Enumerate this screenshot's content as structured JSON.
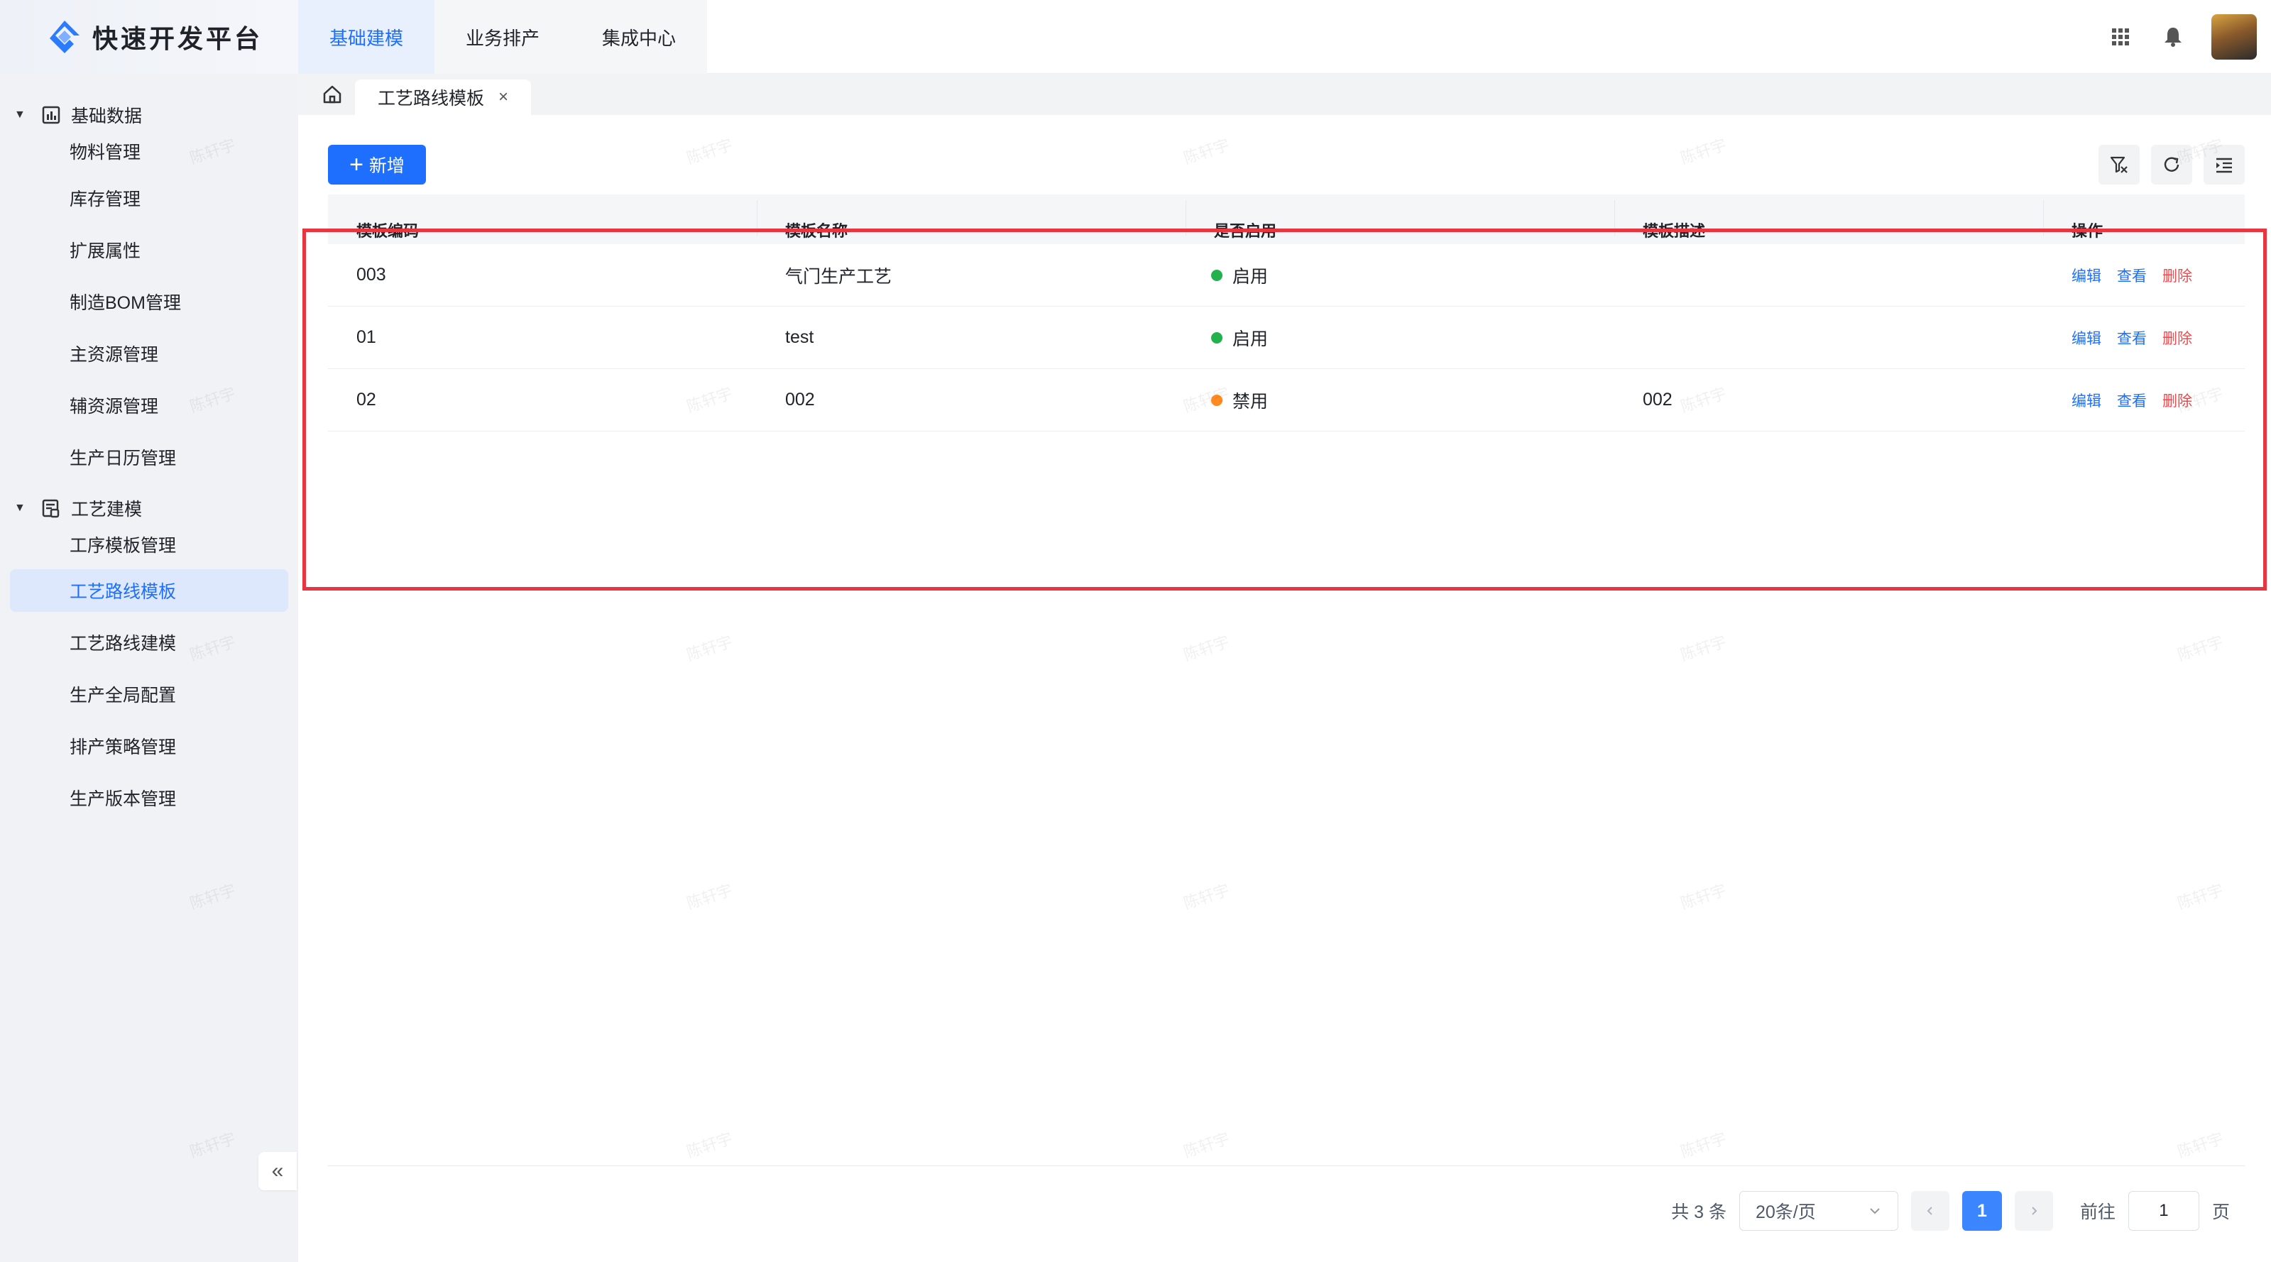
{
  "app": {
    "title": "快速开发平台",
    "top_nav": [
      {
        "label": "基础建模",
        "active": true
      },
      {
        "label": "业务排产",
        "active": false
      },
      {
        "label": "集成中心",
        "active": false
      }
    ],
    "header_icons": [
      "apps-grid-icon",
      "bell-icon",
      "user-avatar"
    ]
  },
  "sidebar": {
    "groups": [
      {
        "label": "基础数据",
        "icon": "bar-chart-icon",
        "items": [
          "物料管理",
          "库存管理",
          "扩展属性",
          "制造BOM管理",
          "主资源管理",
          "辅资源管理",
          "生产日历管理"
        ]
      },
      {
        "label": "工艺建模",
        "icon": "document-icon",
        "items": [
          "工序模板管理",
          "工艺路线模板",
          "工艺路线建模",
          "生产全局配置",
          "排产策略管理",
          "生产版本管理"
        ]
      }
    ],
    "active_item": "工艺路线模板",
    "collapse_label": "«"
  },
  "tabs": {
    "current": "工艺路线模板",
    "close_label": "×"
  },
  "toolbar": {
    "add_label": "新增",
    "add_icon": "+"
  },
  "table": {
    "headers": [
      "模板编码",
      "模板名称",
      "是否启用",
      "模板描述",
      "操作"
    ],
    "rows": [
      {
        "code": "003",
        "name": "气门生产工艺",
        "status": "启用",
        "status_color": "#22b14c",
        "desc": ""
      },
      {
        "code": "01",
        "name": "test",
        "status": "启用",
        "status_color": "#22b14c",
        "desc": ""
      },
      {
        "code": "02",
        "name": "002",
        "status": "禁用",
        "status_color": "#ff8a1f",
        "desc": "002"
      }
    ],
    "actions": {
      "edit": "编辑",
      "view": "查看",
      "delete": "删除"
    }
  },
  "pagination": {
    "total": "共 3 条",
    "page_size": "20条/页",
    "current_page": "1",
    "goto_label": "前往",
    "goto_value": "1",
    "page_unit": "页"
  },
  "watermark": "陈轩宇",
  "colors": {
    "primary": "#1f6fff",
    "danger": "#f5484c",
    "enabled": "#22b14c",
    "disabled": "#ff8a1f",
    "highlight": "#e8353f"
  }
}
